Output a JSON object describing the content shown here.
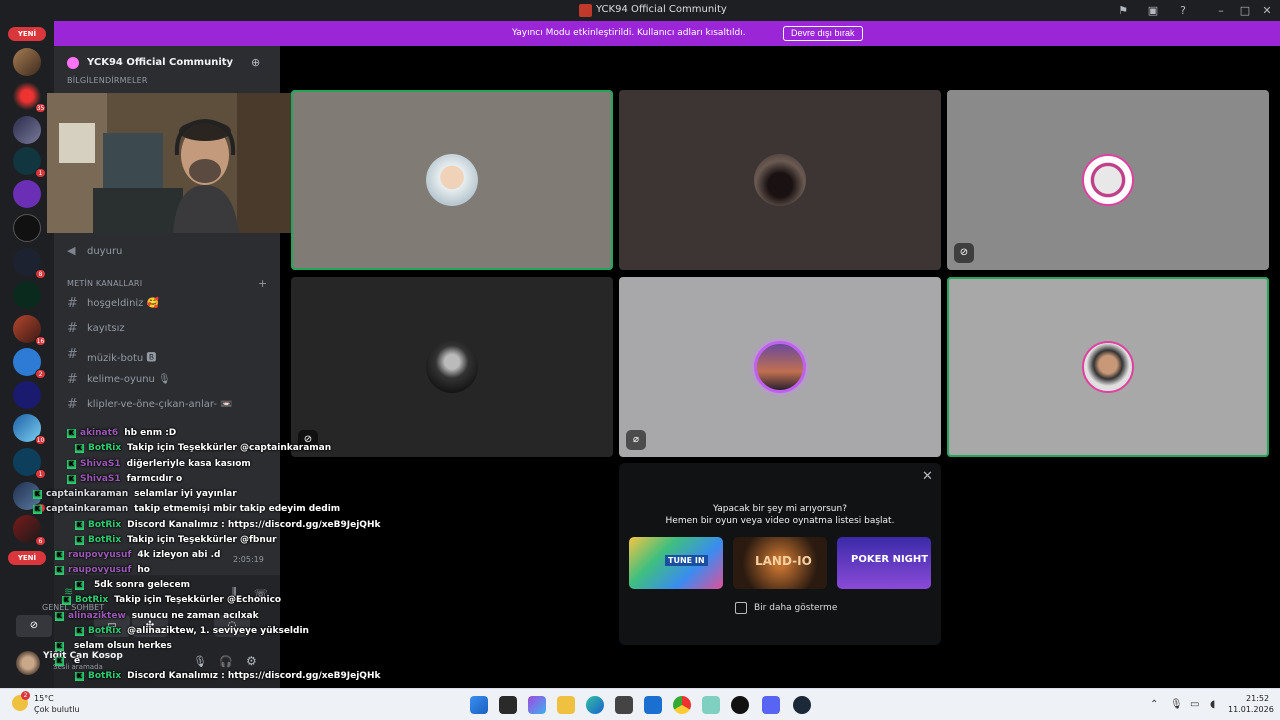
{
  "window": {
    "title": "YCK94 Official Community"
  },
  "banner": {
    "text": "Yayıncı Modu etkinleştirildi. Kullanıcı adları kısaltıldı.",
    "button": "Devre dışı bırak"
  },
  "rail": {
    "new_label": "YENİ",
    "badges": [
      "35",
      "1",
      "8",
      "16",
      "2",
      "10",
      "1",
      "4",
      "6"
    ]
  },
  "sidebar": {
    "server_name": "YCK94 Official Community",
    "category_top": "BİLGİLENDİRMELER",
    "category_text": "METİN KANALLARI",
    "channels": [
      {
        "name": "duyuru",
        "icon": "megaphone-icon"
      },
      {
        "name": "hoşgeldiniz 🥰",
        "icon": "hash-icon"
      },
      {
        "name": "kayıtsız",
        "icon": "hash-icon"
      },
      {
        "name": "müzik-botu 🅱",
        "icon": "hash-icon"
      },
      {
        "name": "kelime-oyunu 🎙",
        "icon": "hash-icon"
      },
      {
        "name": "klipler-ve-öne-çıkan-anlar- 📼",
        "icon": "hash-icon"
      }
    ],
    "voice_status": "Ses Bağlantısı Kuruldu",
    "voice_channel": "GENEL SOHBET",
    "voice_timer": "2:05:19",
    "user_name": "Yiğit Can Kosop",
    "user_status": "Sesli aramada"
  },
  "promo": {
    "title_line1": "Yapacak bir şey mi arıyorsun?",
    "title_line2": "Hemen bir oyun veya video oynatma listesi başlat.",
    "cards": [
      "TUNE IN",
      "LAND-IO",
      "POKER NIGHT"
    ],
    "checkbox_label": "Bir daha gösterme"
  },
  "chat": [
    {
      "user": "akinat6",
      "color": "#9b59b6",
      "msg": "hb enm :D"
    },
    {
      "user": "BotRix",
      "color": "#2ecc71",
      "msg": "Takip için Teşekkürler @captainkaraman"
    },
    {
      "user": "ShivaS1",
      "color": "#9b59b6",
      "msg": "diğerleriyle kasa kasıom"
    },
    {
      "user": "ShivaS1",
      "color": "#9b59b6",
      "msg": "farmcıdır o"
    },
    {
      "user": "captainkaraman",
      "color": "#dbdee1",
      "msg": "selamlar iyi yayınlar"
    },
    {
      "user": "captainkaraman",
      "color": "#dbdee1",
      "msg": "takip etmemişi mbir takip edeyim dedim"
    },
    {
      "user": "BotRix",
      "color": "#2ecc71",
      "msg": "Discord Kanalımız : https://discord.gg/xeB9JejQHk"
    },
    {
      "user": "BotRix",
      "color": "#2ecc71",
      "msg": "Takip için Teşekkürler @fbnur"
    },
    {
      "user": "raupovyusuf",
      "color": "#9b59b6",
      "msg": "4k izleyon abi .d"
    },
    {
      "user": "raupovyusuf",
      "color": "#9b59b6",
      "msg": "ho"
    },
    {
      "user": "",
      "color": "#9b59b6",
      "msg": "5dk sonra gelecem"
    },
    {
      "user": "BotRix",
      "color": "#2ecc71",
      "msg": "Takip için Teşekkürler @Echonico"
    },
    {
      "user": "alinaziktew",
      "color": "#9b59b6",
      "msg": "sunucu ne zaman acılxak"
    },
    {
      "user": "BotRix",
      "color": "#2ecc71",
      "msg": "@alinaziktew, 1. seviyeye yükseldin"
    },
    {
      "user": "",
      "color": "#9b59b6",
      "msg": "selam olsun herkes"
    },
    {
      "user": "",
      "color": "#9b59b6",
      "msg": "e"
    },
    {
      "user": "BotRix",
      "color": "#2ecc71",
      "msg": "Discord Kanalımız : https://discord.gg/xeB9JejQHk"
    }
  ],
  "taskbar": {
    "weather_temp": "15°C",
    "weather_desc": "Çok bulutlu",
    "weather_alert": "2",
    "time": "21:52",
    "date": "11.01.2026"
  },
  "colors": {
    "banner": "#9b26d8",
    "speaking": "#23a55a",
    "bot": "#2ecc71",
    "badge": "#da373c"
  }
}
